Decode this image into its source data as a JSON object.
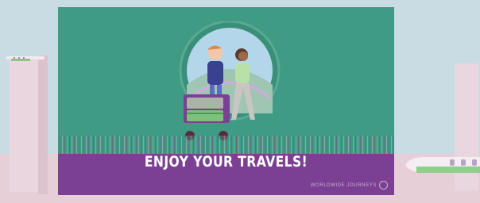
{
  "slide": {
    "headline": "ENJOY YOUR TRAVELS!",
    "watermark": "WORLDWIDE JOURNEYS"
  },
  "colors": {
    "slide_background": "#3f9b83",
    "banner": "#7b3f93",
    "scene_background": "#c9dbe3"
  },
  "icons": [
    "travelers-illustration",
    "luggage-cart-icon",
    "airplane-icon",
    "globe-icon"
  ]
}
